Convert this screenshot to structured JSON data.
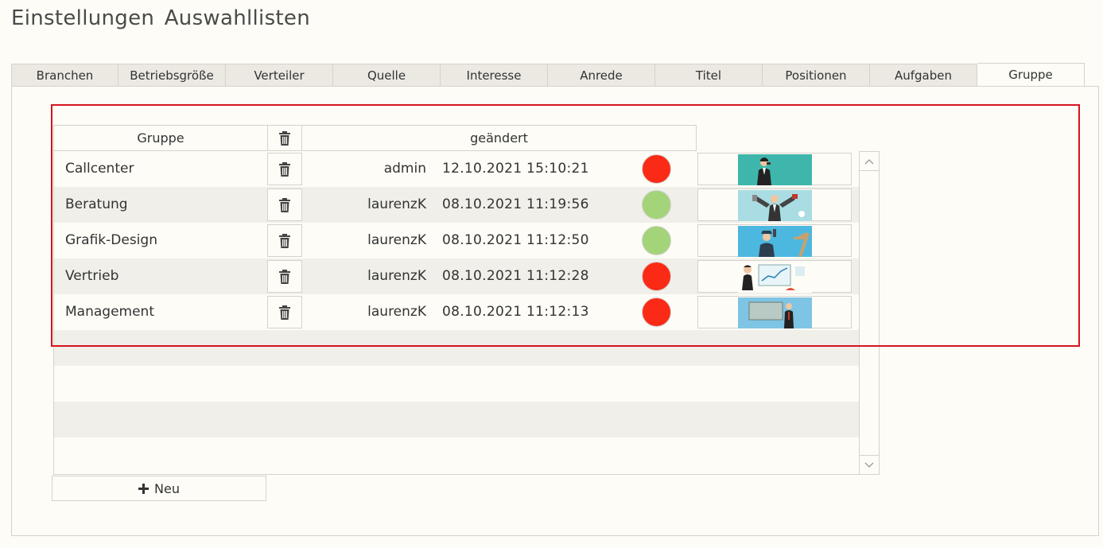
{
  "page": {
    "title": "Einstellungen  Auswahllisten"
  },
  "tabs": [
    {
      "label": "Branchen",
      "active": false
    },
    {
      "label": "Betriebsgröße",
      "active": false
    },
    {
      "label": "Verteiler",
      "active": false
    },
    {
      "label": "Quelle",
      "active": false
    },
    {
      "label": "Interesse",
      "active": false
    },
    {
      "label": "Anrede",
      "active": false
    },
    {
      "label": "Titel",
      "active": false
    },
    {
      "label": "Positionen",
      "active": false
    },
    {
      "label": "Aufgaben",
      "active": false
    },
    {
      "label": "Gruppe",
      "active": true
    }
  ],
  "table": {
    "headers": {
      "gruppe": "Gruppe",
      "geaendert": "geändert"
    },
    "rows": [
      {
        "name": "Callcenter",
        "user": "admin",
        "date": "12.10.2021 15:10:21",
        "status": "red",
        "image": "callcenter-thumbnail"
      },
      {
        "name": "Beratung",
        "user": "laurenzK",
        "date": "08.10.2021 11:19:56",
        "status": "green",
        "image": "beratung-thumbnail"
      },
      {
        "name": "Grafik-Design",
        "user": "laurenzK",
        "date": "08.10.2021 11:12:50",
        "status": "green",
        "image": "grafik-design-thumbnail"
      },
      {
        "name": "Vertrieb",
        "user": "laurenzK",
        "date": "08.10.2021 11:12:28",
        "status": "red",
        "image": "vertrieb-thumbnail"
      },
      {
        "name": "Management",
        "user": "laurenzK",
        "date": "08.10.2021 11:12:13",
        "status": "red",
        "image": "management-thumbnail"
      }
    ]
  },
  "buttons": {
    "new_label": "Neu"
  },
  "colors": {
    "status_red": "#fb2a17",
    "status_green": "#a3d47a",
    "highlight": "#d6141e"
  }
}
